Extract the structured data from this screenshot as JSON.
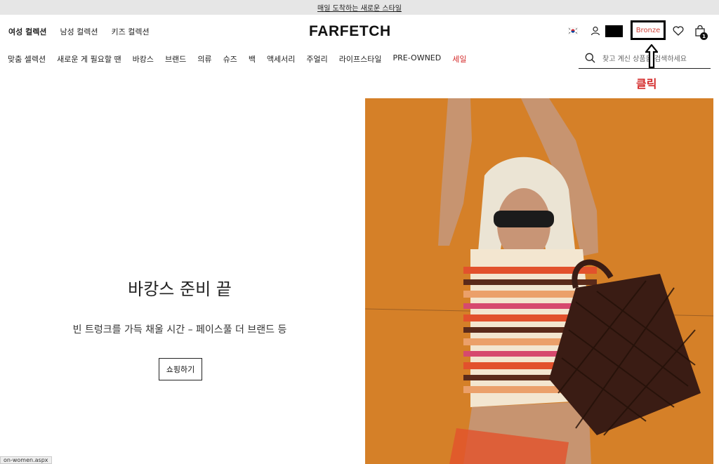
{
  "topbar": {
    "text": "매일 도착하는 새로운 스타일"
  },
  "gender_nav": [
    "여성 컬렉션",
    "남성 컬렉션",
    "키즈 컬렉션"
  ],
  "logo": "FARFETCH",
  "header": {
    "membership_tier": "Bronze",
    "bag_count": "1",
    "icons": [
      "korea-flag-icon",
      "user-icon",
      "heart-icon",
      "shopping-bag-icon"
    ]
  },
  "categories": [
    "맞춤 셀렉션",
    "새로운 게 필요할 땐",
    "바캉스",
    "브랜드",
    "의류",
    "슈즈",
    "백",
    "액세서리",
    "주얼리",
    "라이프스타일",
    "PRE-OWNED",
    "세일"
  ],
  "search": {
    "placeholder": "찾고 계신 상품을 검색하세요"
  },
  "annotation": {
    "label": "클릭"
  },
  "hero": {
    "title": "바캉스 준비 끝",
    "subtitle": "빈 트렁크를 가득 채울 시간 – 페이스풀 더 브랜드 등",
    "button": "쇼핑하기"
  },
  "status_bar": {
    "url": "on-women.aspx"
  },
  "colors": {
    "accent_red": "#d42b2b",
    "bronze": "#d0453c",
    "hero_bg": "#d9832a"
  }
}
